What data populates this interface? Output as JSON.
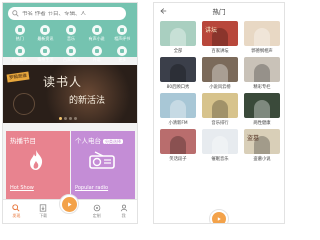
{
  "left": {
    "search": {
      "placeholder": "书名 作者 节目、专辑、人"
    },
    "categories": [
      {
        "label": "热门",
        "icon": "fire-icon"
      },
      {
        "label": "最新资讯",
        "icon": "news-icon"
      },
      {
        "label": "音乐",
        "icon": "music-icon"
      },
      {
        "label": "有声小说",
        "icon": "book-icon"
      },
      {
        "label": "相声评书",
        "icon": "storyteller-icon"
      },
      {
        "label": "综艺娱乐",
        "icon": "variety-icon"
      },
      {
        "label": "情感生活",
        "icon": "heart-icon"
      },
      {
        "label": "百家讲坛",
        "icon": "lecture-icon"
      },
      {
        "label": "外语",
        "icon": "language-icon"
      },
      {
        "label": "更多",
        "icon": "more-icon"
      }
    ],
    "banner": {
      "tag": "罗辑思维",
      "title": "读书人",
      "subtitle": "的新活法"
    },
    "tiles": [
      {
        "title": "热播节目",
        "caption": "Hot Show",
        "icon": "flame-icon"
      },
      {
        "title": "个人电台",
        "badge": "分类选择",
        "caption": "Popular radio",
        "icon": "radio-icon"
      }
    ],
    "tabbar": [
      {
        "label": "发现",
        "icon": "discover-icon",
        "active": true
      },
      {
        "label": "下载",
        "icon": "download-icon",
        "active": false
      },
      {
        "label": "",
        "icon": "play-icon",
        "active": false
      },
      {
        "label": "定制",
        "icon": "radio-custom-icon",
        "active": false
      },
      {
        "label": "我",
        "icon": "user-icon",
        "active": false
      }
    ]
  },
  "right": {
    "header": {
      "title": "热门"
    },
    "items": [
      {
        "label": "全部",
        "color": "#a9cfc0",
        "text": ""
      },
      {
        "label": "百家讲坛",
        "color": "#b8473b",
        "text": "讲坛"
      },
      {
        "label": "郭德纲相声",
        "color": "#e8d8c4",
        "text": ""
      },
      {
        "label": "80后顾口秀",
        "color": "#3b3f4a",
        "text": ""
      },
      {
        "label": "小说风云榜",
        "color": "#7b6a5a",
        "text": ""
      },
      {
        "label": "精彩专栏",
        "color": "#c9c2b8",
        "text": ""
      },
      {
        "label": "小清新FM",
        "color": "#a8c7d6",
        "text": ""
      },
      {
        "label": "音乐排行",
        "color": "#d7c38c",
        "text": ""
      },
      {
        "label": "两性健康",
        "color": "#3a4a3a",
        "text": ""
      },
      {
        "label": "笑话段子",
        "color": "#b96d6d",
        "text": ""
      },
      {
        "label": "催眠音乐",
        "color": "#e7ebef",
        "text": ""
      },
      {
        "label": "盗墓小说",
        "color": "#d9cfb8",
        "text": "盗墓"
      }
    ]
  }
}
